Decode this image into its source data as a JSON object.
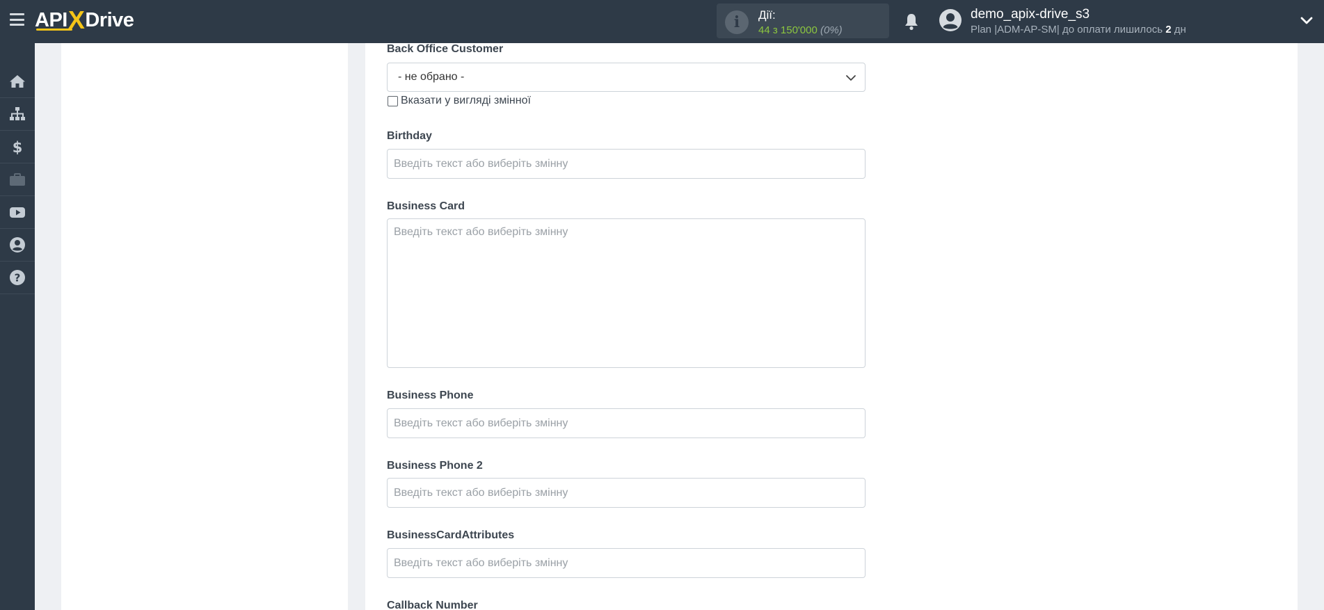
{
  "header": {
    "logo": {
      "left": "API",
      "x": "X",
      "right": "Drive"
    },
    "actions": {
      "label": "Дії:",
      "count": "44",
      "sep": " з ",
      "limit": "150'000",
      "percent": "(0%)"
    },
    "user": {
      "name": "demo_apix-drive_s3",
      "plan_prefix": "Plan |ADM-AP-SM| до оплати лишилось ",
      "plan_days": "2",
      "plan_suffix": " дн"
    }
  },
  "sidebar": {
    "items": [
      {
        "icon": "home-icon"
      },
      {
        "icon": "sitemap-icon"
      },
      {
        "icon": "dollar-icon"
      },
      {
        "icon": "briefcase-icon"
      },
      {
        "icon": "youtube-icon"
      },
      {
        "icon": "user-circle-icon"
      },
      {
        "icon": "help-circle-icon"
      }
    ]
  },
  "form": {
    "back_office": {
      "label": "Back Office Customer",
      "selected": "- не обрано -",
      "checkbox_label": "Вказати у вигляді змінної"
    },
    "birthday": {
      "label": "Birthday",
      "placeholder": "Введіть текст або виберіть змінну"
    },
    "business_card": {
      "label": "Business Card",
      "placeholder": "Введіть текст або виберіть змінну"
    },
    "business_phone": {
      "label": "Business Phone",
      "placeholder": "Введіть текст або виберіть змінну"
    },
    "business_phone_2": {
      "label": "Business Phone 2",
      "placeholder": "Введіть текст або виберіть змінну"
    },
    "business_card_attributes": {
      "label": "BusinessCardAttributes",
      "placeholder": "Введіть текст або виберіть змінну"
    },
    "callback_number": {
      "label": "Callback Number"
    }
  },
  "colors": {
    "topbar": "#2e3a47",
    "accent_yellow": "#f5c518",
    "accent_green": "#8cc63f",
    "page_bg": "#eef0f3"
  }
}
